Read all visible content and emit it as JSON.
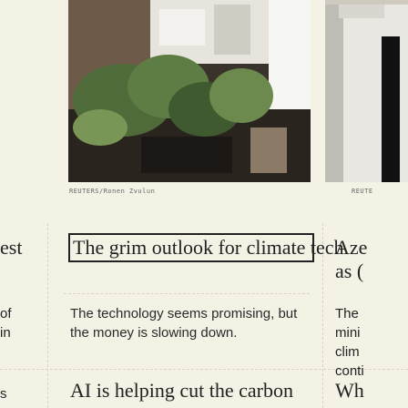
{
  "left_column": {
    "headline_fragment": "est",
    "line1": "of",
    "line2": "in",
    "line3": "s"
  },
  "center_card": {
    "image_credit": "REUTERS/Ronen Zvulun",
    "headline": "The grim outlook for climate tech",
    "subhead": "The technology seems promising, but the money is slowing down."
  },
  "right_card": {
    "image_credit": "REUTE",
    "headline_line1": "Aze",
    "headline_line2": "as (",
    "sub_line1": "The",
    "sub_line2": "mini",
    "sub_line3": "clim",
    "sub_line4": "conti"
  },
  "bottom_card": {
    "headline": "AI is helping cut the carbon",
    "right_headline": "Wh"
  }
}
